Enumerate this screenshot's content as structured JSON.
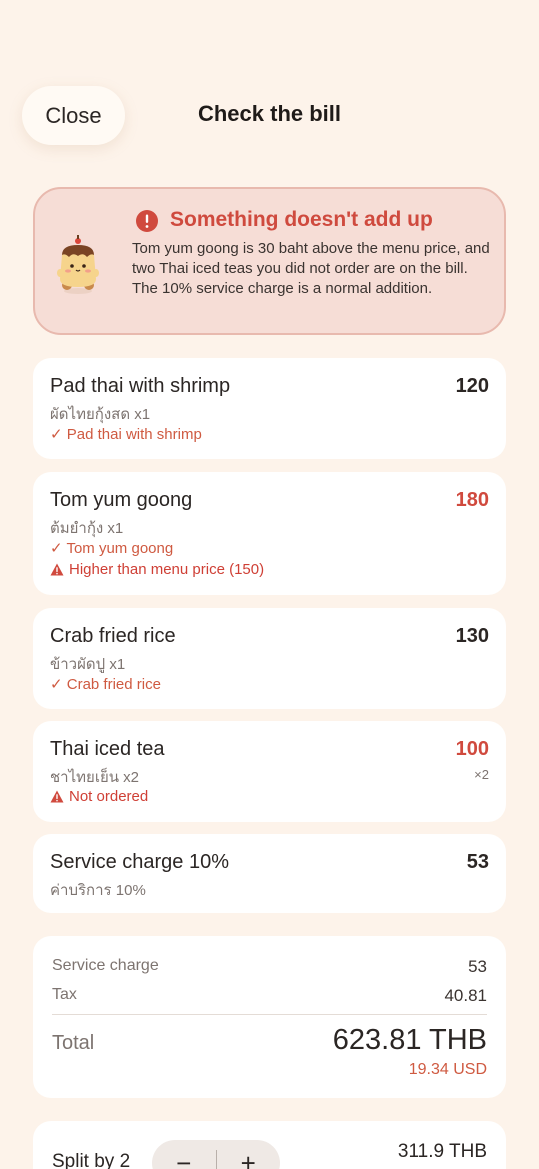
{
  "header": {
    "close_label": "Close",
    "title": "Check the bill"
  },
  "alert": {
    "title": "Something doesn't add up",
    "body": "Tom yum goong is 30 baht above the menu price, and two Thai iced teas you did not order are on the bill. The 10% service charge is a normal addition."
  },
  "items": [
    {
      "name": "Pad thai with shrimp",
      "sub": "ผัดไทยกุ้งสด x1",
      "price": "120",
      "check": "✓ Pad thai with shrimp"
    },
    {
      "name": "Tom yum goong",
      "sub": "ต้มยำกุ้ง x1",
      "price": "180",
      "check": "✓ Tom yum goong",
      "warning": "Higher than menu price (150)"
    },
    {
      "name": "Crab fried rice",
      "sub": "ข้าวผัดปู x1",
      "price": "130",
      "check": "✓ Crab fried rice"
    },
    {
      "name": "Thai iced tea",
      "sub": "ชาไทยเย็น x2",
      "price": "100",
      "qty": "×2",
      "warning": "Not ordered"
    },
    {
      "name": "Service charge 10%",
      "sub": "ค่าบริการ 10%",
      "price": "53"
    }
  ],
  "summary": {
    "service_label": "Service charge",
    "service_value": "53",
    "tax_label": "Tax",
    "tax_value": "40.81",
    "total_label": "Total",
    "total_value": "623.81 THB",
    "total_usd": "19.34 USD"
  },
  "split": {
    "label": "Split by 2",
    "minus": "−",
    "plus": "+",
    "value": "311.9 THB"
  },
  "colors": {
    "background": "#fdf3ea",
    "alert_bg": "#f6ddd6",
    "alert_accent": "#cf4a3e",
    "ok_accent": "#cf5a41"
  }
}
